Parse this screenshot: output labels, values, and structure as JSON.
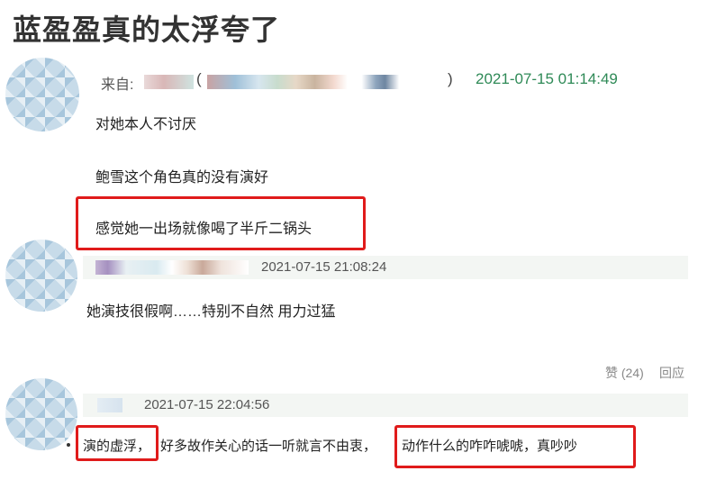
{
  "page_title": "蓝盈盈真的太浮夸了",
  "comments": [
    {
      "from_label": "来自:",
      "open_paren": "(",
      "close_paren": ")",
      "timestamp": "2021-07-15 01:14:49",
      "lines": [
        "对她本人不讨厌",
        "鲍雪这个角色真的没有演好",
        "感觉她一出场就像喝了半斤二锅头"
      ]
    },
    {
      "timestamp": "2021-07-15 21:08:24",
      "lines": [
        "她演技很假啊……特别不自然 用力过猛"
      ],
      "like_label": "赞 (24)",
      "reply_label": "回应"
    },
    {
      "timestamp": "2021-07-15 22:04:56",
      "segments": [
        "演的虚浮，",
        "好多故作关心的话一听就言不由衷，",
        "动作什么的咋咋唬唬，真吵吵"
      ]
    }
  ],
  "colors": {
    "highlight_box": "#e01b1b",
    "timestamp_green": "#2f8a57",
    "meta_bar_bg": "#f3f6f3"
  }
}
